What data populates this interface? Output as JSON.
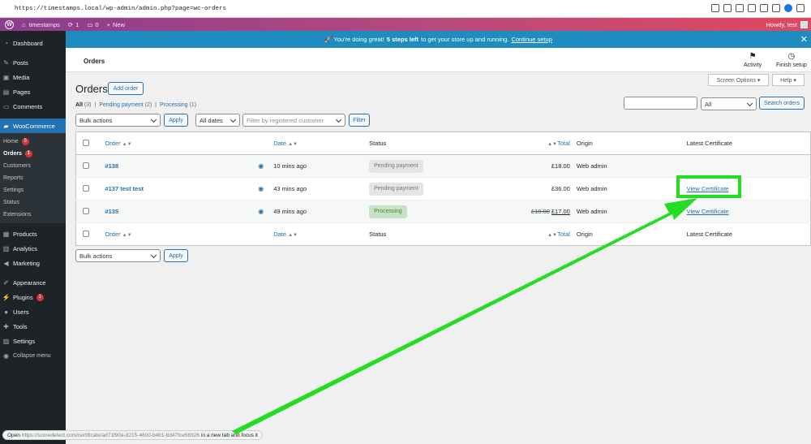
{
  "browser": {
    "url": "https://timestamps.local/wp-admin/admin.php?page=wc-orders"
  },
  "adminbar": {
    "site_name": "timestamps",
    "updates_count": "1",
    "comments_count": "0",
    "new_label": "New",
    "howdy": "Howdy, test"
  },
  "notice": {
    "prefix": "🚀 You're doing great!",
    "bold": "5 steps left",
    "rest": "to get your store up and running.",
    "link": "Continue setup",
    "close": "✕"
  },
  "sidebar": {
    "dashboard": "Dashboard",
    "posts": "Posts",
    "media": "Media",
    "pages": "Pages",
    "comments": "Comments",
    "woocommerce": "WooCommerce",
    "sub": {
      "home": "Home",
      "home_badge": "5",
      "orders": "Orders",
      "orders_badge": "1",
      "customers": "Customers",
      "reports": "Reports",
      "settings": "Settings",
      "status": "Status",
      "extensions": "Extensions"
    },
    "products": "Products",
    "analytics": "Analytics",
    "marketing": "Marketing",
    "appearance": "Appearance",
    "plugins": "Plugins",
    "plugins_badge": "1",
    "users": "Users",
    "tools": "Tools",
    "settings": "Settings",
    "collapse": "Collapse menu"
  },
  "header": {
    "title": "Orders",
    "activity": "Activity",
    "finish_setup": "Finish setup"
  },
  "screen_options": "Screen Options ▾",
  "help": "Help ▾",
  "page": {
    "title": "Orders",
    "add_order": "Add order"
  },
  "filters_links": {
    "all": "All",
    "all_count": "(3)",
    "pending": "Pending payment",
    "pending_count": "(2)",
    "processing": "Processing",
    "processing_count": "(1)",
    "sep": "|"
  },
  "search": {
    "value": "",
    "type_select": "All",
    "button": "Search orders"
  },
  "toolbar": {
    "bulk_actions": "Bulk actions",
    "apply": "Apply",
    "dates": "All dates",
    "customer_placeholder": "Filter by registered customer",
    "filter": "Filter"
  },
  "table": {
    "columns": {
      "order": "Order",
      "date": "Date",
      "status": "Status",
      "total": "Total",
      "origin": "Origin",
      "certificate": "Latest Certificate"
    },
    "rows": [
      {
        "order": "#138",
        "date": "10 mins ago",
        "status": "Pending payment",
        "total_old": "",
        "total": "£18.00",
        "origin": "Web admin",
        "certificate": ""
      },
      {
        "order": "#137 test test",
        "date": "43 mins ago",
        "status": "Pending payment",
        "total_old": "",
        "total": "£36.00",
        "origin": "Web admin",
        "certificate": "View Certificate"
      },
      {
        "order": "#135",
        "date": "49 mins ago",
        "status": "Processing",
        "total_old": "£18.00",
        "total": "£17.00",
        "origin": "Web admin",
        "certificate": "View Certificate"
      }
    ]
  },
  "bottom_toolbar": {
    "bulk_actions": "Bulk actions",
    "apply": "Apply"
  },
  "status_tooltip": {
    "open": "Open",
    "url": "https://scoredetect.com/certificate/ad71f90a-d215-4600-b4b1-bd47fce58326",
    "rest": "in a new tab and focus it"
  },
  "colors": {
    "accent": "#2271b1",
    "notice_bg": "#1e8cbe",
    "highlight": "#22dd22"
  }
}
